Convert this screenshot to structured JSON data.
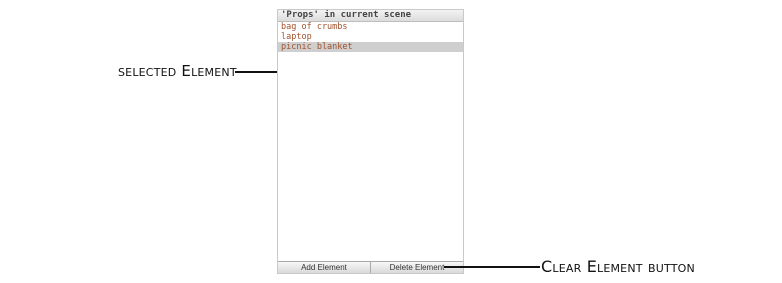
{
  "callouts": {
    "selected_element": "selected Element",
    "clear_element_button": "Clear Element button"
  },
  "panel": {
    "title": "'Props' in current scene",
    "items": [
      "bag of crumbs",
      "laptop",
      "picnic blanket"
    ],
    "selected_index": 2,
    "buttons": {
      "add": "Add Element",
      "delete": "Delete Element"
    }
  },
  "colors": {
    "item_text": "#a0522d",
    "selection": "#cfcfcf"
  }
}
